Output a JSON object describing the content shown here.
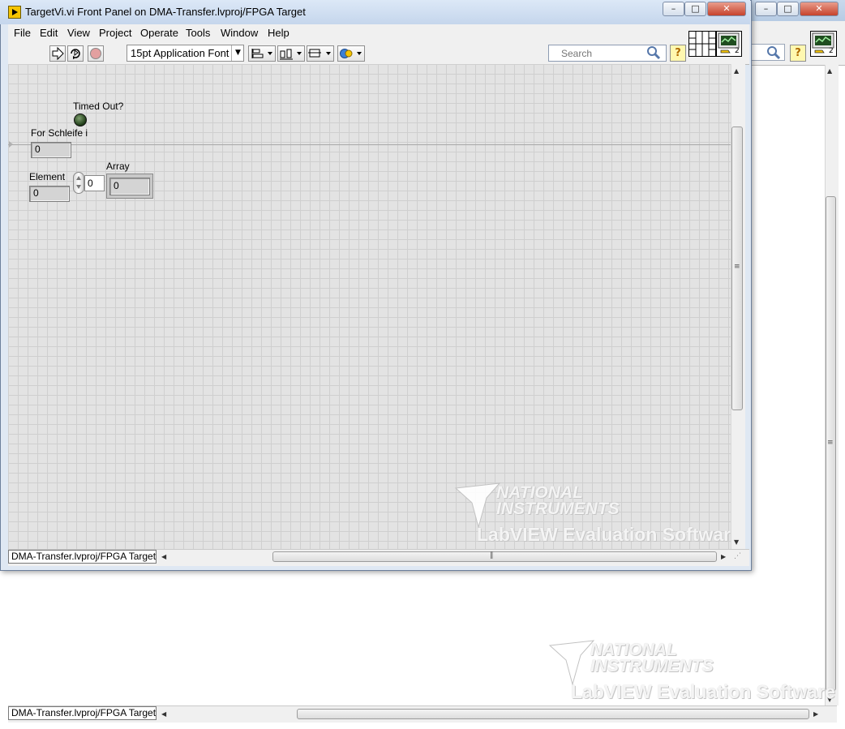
{
  "window": {
    "title": "TargetVi.vi Front Panel on DMA-Transfer.lvproj/FPGA Target",
    "minimize_icon": "minimize-icon",
    "maximize_icon": "maximize-icon",
    "close_icon": "close-icon"
  },
  "menu": [
    "File",
    "Edit",
    "View",
    "Project",
    "Operate",
    "Tools",
    "Window",
    "Help"
  ],
  "toolbar": {
    "run_icon": "run-arrow-icon",
    "run_continuous_icon": "run-continuously-icon",
    "abort_icon": "abort-icon",
    "font": "15pt Application Font",
    "align_icon": "align-objects-icon",
    "distribute_icon": "distribute-objects-icon",
    "resize_icon": "resize-objects-icon",
    "reorder_icon": "reorder-icon",
    "search_placeholder": "Search",
    "help_label": "?"
  },
  "panel": {
    "timed_out_label": "Timed Out?",
    "for_loop_label": "For Schleife i",
    "for_loop_value": "0",
    "element_label": "Element",
    "element_value": "0",
    "array_label": "Array",
    "array_index": "0",
    "array_value": "0"
  },
  "connector": {
    "terminal_number": "2"
  },
  "watermark": {
    "line1": "NATIONAL",
    "line2": "INSTRUMENTS",
    "line3": "LabVIEW Evaluation Software"
  },
  "status": {
    "context": "DMA-Transfer.lvproj/FPGA Target"
  },
  "bg_window": {
    "status_context": "DMA-Transfer.lvproj/FPGA Target",
    "connector_terminal": "2",
    "help_label": "?"
  },
  "colors": {
    "panel_bg": "#e3e3e3",
    "grid_line": "#cfcfcf",
    "led_off": "#1d3a16",
    "title_bar": "#c5d6ec"
  }
}
